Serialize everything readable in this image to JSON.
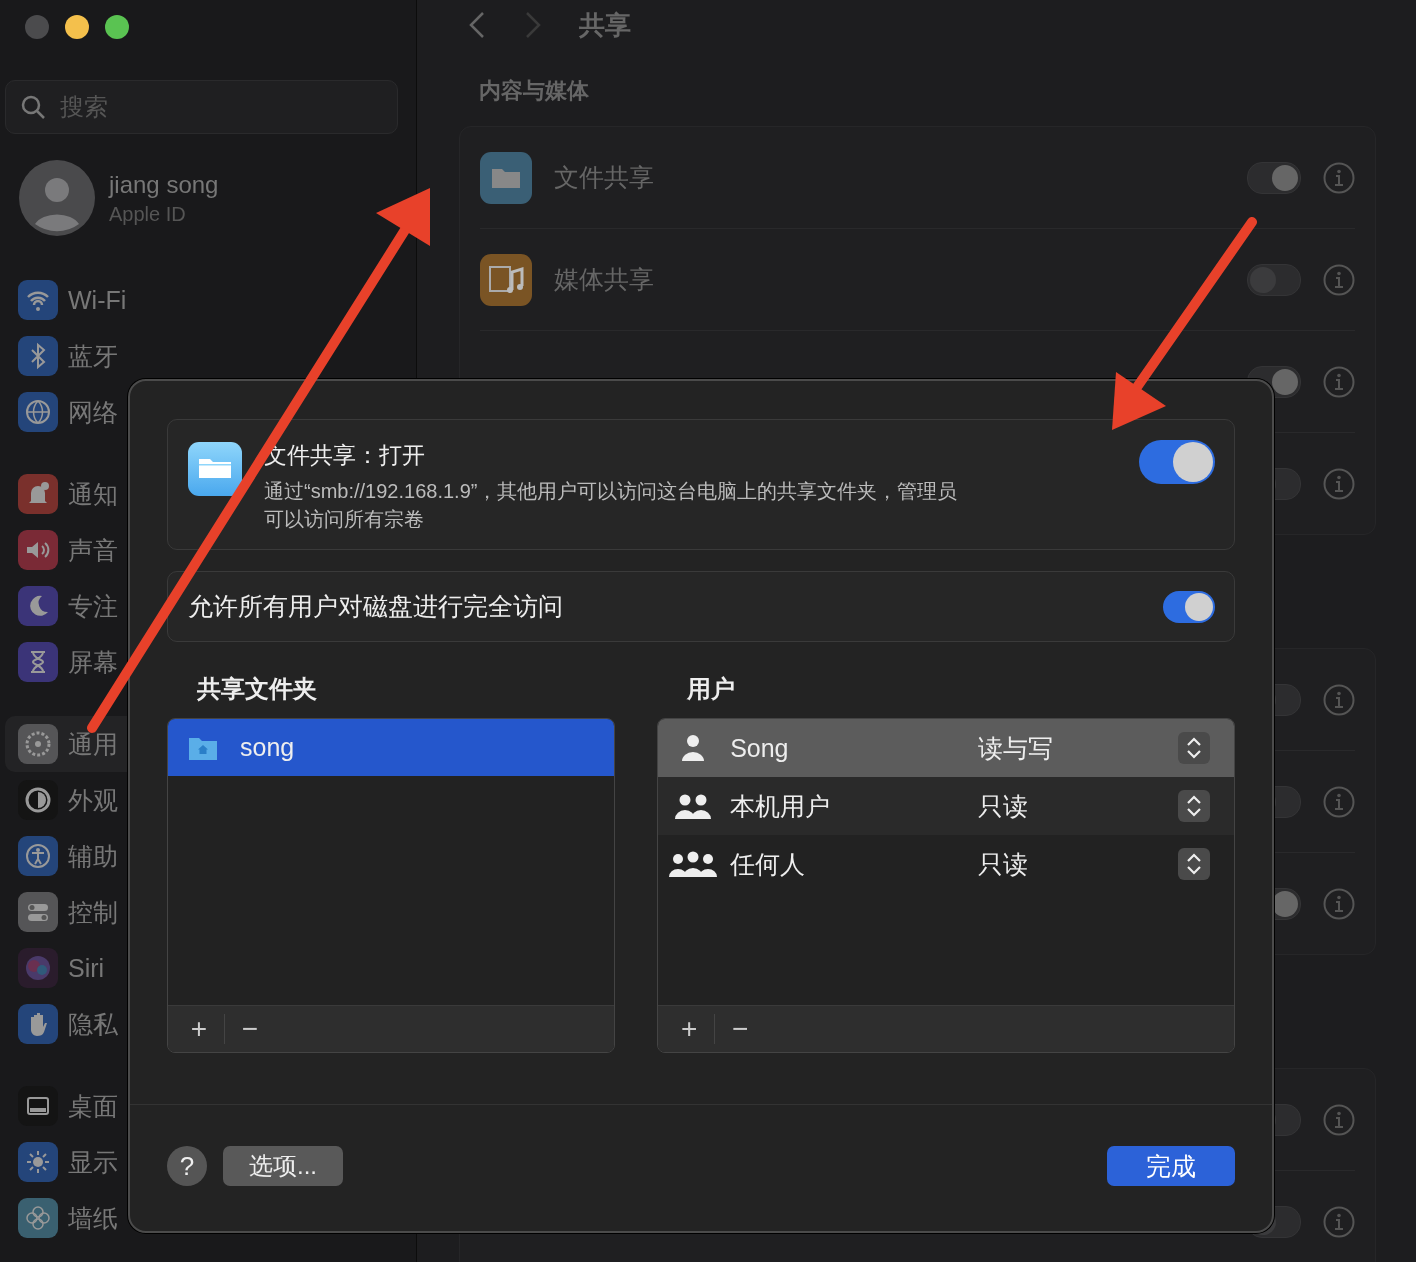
{
  "window": {
    "controls": [
      {
        "color": "#4b4b4d"
      },
      {
        "color": "#f4c04c"
      },
      {
        "color": "#5ac352"
      }
    ]
  },
  "sidebar": {
    "search": {
      "placeholder": "搜索"
    },
    "account": {
      "name": "jiang song",
      "subtitle": "Apple ID"
    },
    "groups": [
      {
        "items": [
          {
            "label": "Wi-Fi",
            "color": "#24457a",
            "selected": false
          },
          {
            "label": "蓝牙",
            "color": "#24457a",
            "selected": false
          },
          {
            "label": "网络",
            "color": "#24457a",
            "selected": false
          }
        ]
      },
      {
        "items": [
          {
            "label": "通知",
            "color": "#7a302c",
            "selected": false
          },
          {
            "label": "声音",
            "color": "#7a2a36",
            "selected": false
          },
          {
            "label": "专注",
            "color": "#3b3478",
            "selected": false
          },
          {
            "label": "屏幕",
            "color": "#3b3478",
            "selected": false
          }
        ]
      },
      {
        "items": [
          {
            "label": "通用",
            "color": "#555557",
            "selected": true
          },
          {
            "label": "外观",
            "color": "#141414",
            "selected": false
          },
          {
            "label": "辅助",
            "color": "#24457a",
            "selected": false
          },
          {
            "label": "控制",
            "color": "#555557",
            "selected": false
          },
          {
            "label": "Siri",
            "color": "#2a1c2c",
            "selected": false
          },
          {
            "label": "隐私",
            "color": "#24457a",
            "selected": false
          }
        ]
      },
      {
        "items": [
          {
            "label": "桌面",
            "color": "#141414",
            "selected": false
          },
          {
            "label": "显示",
            "color": "#24457a",
            "selected": false
          },
          {
            "label": "墙纸",
            "color": "#3a6070",
            "selected": false
          }
        ]
      }
    ]
  },
  "main": {
    "title": "共享",
    "section": "内容与媒体",
    "cards": [
      {
        "rows": [
          {
            "label": "文件共享",
            "color": "#3a5f75",
            "on": true
          },
          {
            "label": "媒体共享",
            "color": "#7a5424",
            "on": false
          },
          {
            "on": true
          },
          {
            "on": false
          }
        ]
      },
      {
        "rows": [
          {
            "on": false
          },
          {
            "on": false
          },
          {
            "on": true
          }
        ]
      },
      {
        "rows": [
          {
            "on": false
          },
          {
            "on": false
          }
        ]
      }
    ]
  },
  "sheet": {
    "service": {
      "title": "文件共享：打开",
      "description": "通过“smb://192.168.1.9”，其他用户可以访问这台电脑上的共享文件夹，管理员可以访问所有宗卷",
      "on": true
    },
    "full_access": {
      "label": "允许所有用户对磁盘进行完全访问",
      "on": true
    },
    "folders": {
      "heading": "共享文件夹",
      "items": [
        {
          "name": "song",
          "selected": true
        }
      ],
      "add": "+",
      "remove": "−"
    },
    "users": {
      "heading": "用户",
      "rows": [
        {
          "kind": "user",
          "name": "Song",
          "permission": "读与写",
          "selected": true
        },
        {
          "kind": "group",
          "name": "本机用户",
          "permission": "只读",
          "selected": false
        },
        {
          "kind": "everyone",
          "name": "任何人",
          "permission": "只读",
          "selected": false
        }
      ],
      "add": "+",
      "remove": "−"
    },
    "footer": {
      "help": "?",
      "options": "选项...",
      "done": "完成"
    }
  }
}
